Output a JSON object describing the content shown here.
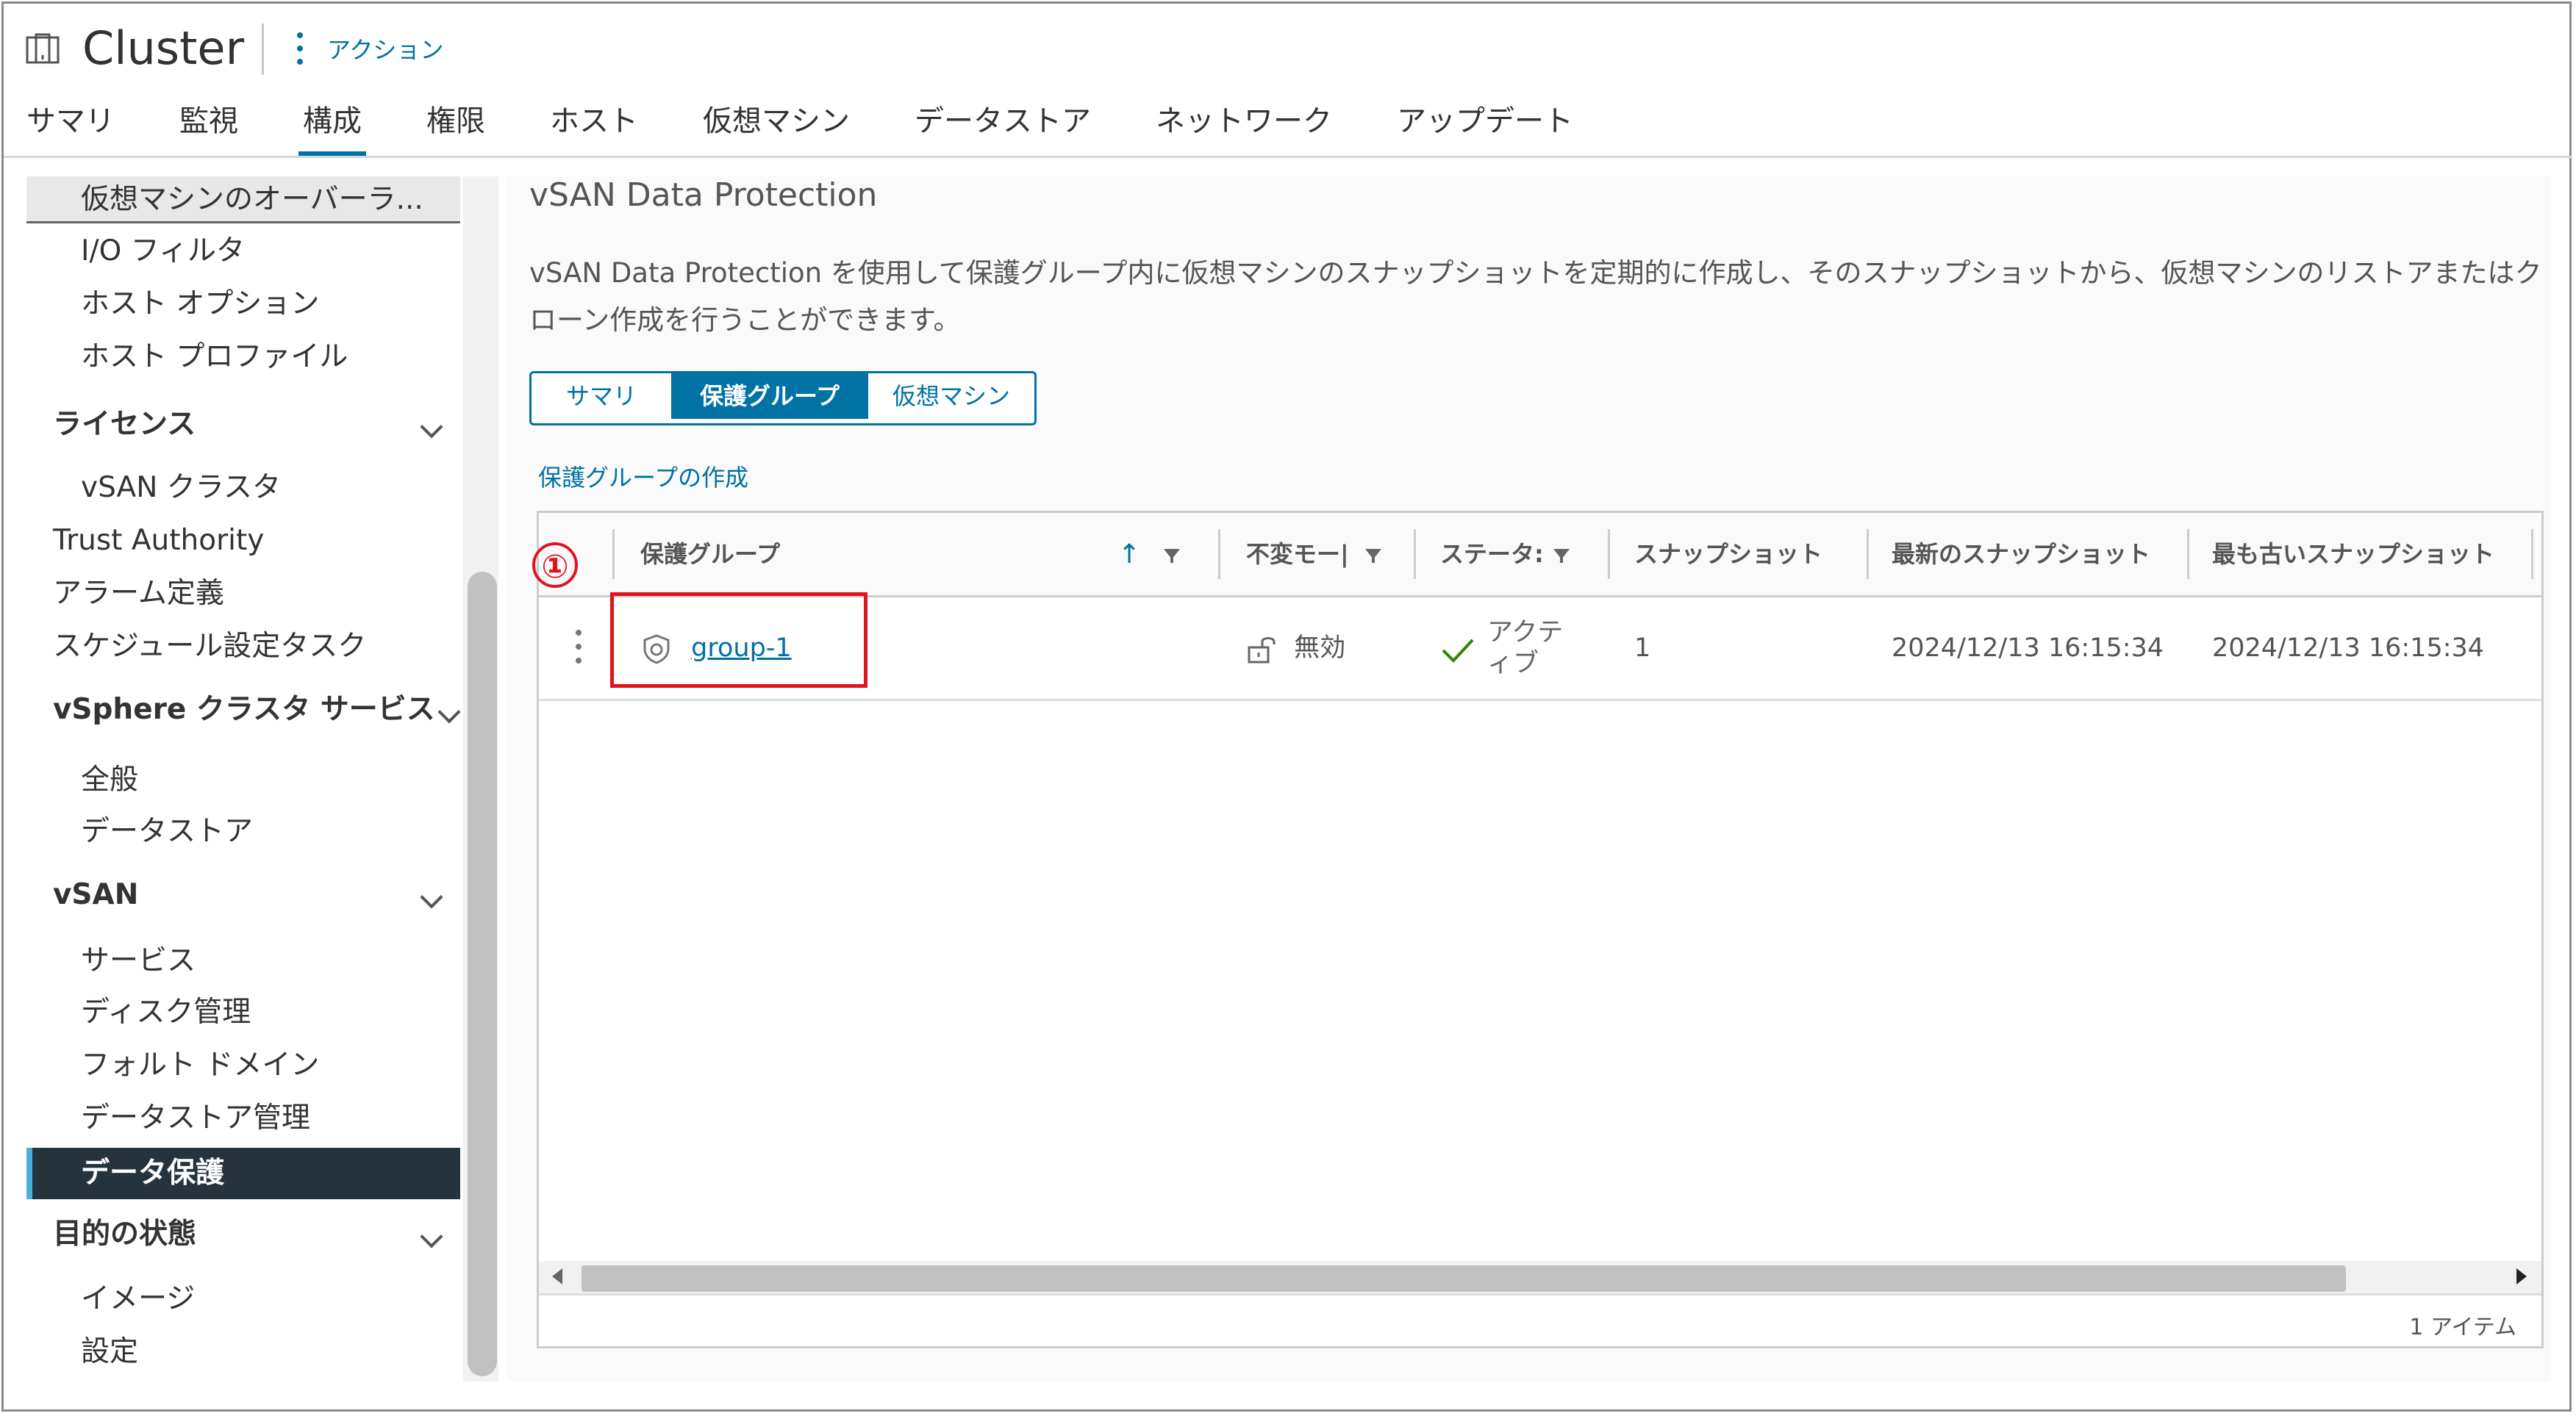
{
  "header": {
    "title": "Cluster",
    "actions_label": "アクション",
    "tabs": [
      "サマリ",
      "監視",
      "構成",
      "権限",
      "ホスト",
      "仮想マシン",
      "データストア",
      "ネットワーク",
      "アップデート"
    ],
    "active_tab": "構成"
  },
  "sidebar": {
    "items": [
      {
        "label": "仮想マシンのオーバーラ...",
        "level": 2,
        "state": "hover"
      },
      {
        "label": "I/O フィルタ",
        "level": 2
      },
      {
        "label": "ホスト オプション",
        "level": 2
      },
      {
        "label": "ホスト プロファイル",
        "level": 2
      },
      {
        "label": "ライセンス",
        "level": "group"
      },
      {
        "label": "vSAN クラスタ",
        "level": 2
      },
      {
        "label": "Trust Authority",
        "level": 1
      },
      {
        "label": "アラーム定義",
        "level": 1
      },
      {
        "label": "スケジュール設定タスク",
        "level": 1
      },
      {
        "label": "vSphere クラスタ サービス",
        "level": "group"
      },
      {
        "label": "全般",
        "level": 2
      },
      {
        "label": "データストア",
        "level": 2
      },
      {
        "label": "vSAN",
        "level": "group"
      },
      {
        "label": "サービス",
        "level": 2
      },
      {
        "label": "ディスク管理",
        "level": 2
      },
      {
        "label": "フォルト ドメイン",
        "level": 2
      },
      {
        "label": "データストア管理",
        "level": 2
      },
      {
        "label": "データ保護",
        "level": 2,
        "state": "selected"
      },
      {
        "label": "目的の状態",
        "level": "group"
      },
      {
        "label": "イメージ",
        "level": 2
      },
      {
        "label": "設定",
        "level": 2
      }
    ]
  },
  "main": {
    "title": "vSAN Data Protection",
    "description": "vSAN Data Protection を使用して保護グループ内に仮想マシンのスナップショットを定期的に作成し、そのスナップショットから、仮想マシンのリストアまたはクローン作成を行うことができます。",
    "subtabs": [
      "サマリ",
      "保護グループ",
      "仮想マシン"
    ],
    "active_subtab": "保護グループ",
    "create_link": "保護グループの作成",
    "grid": {
      "columns": [
        "保護グループ",
        "不変モード",
        "ステータス",
        "スナップショット",
        "最新のスナップショット",
        "最も古いスナップショット"
      ],
      "column_display": [
        "保護グループ",
        "不変モー|",
        "ステータ:",
        "スナップショット",
        "最新のスナップショット",
        "最も古いスナップショット"
      ],
      "rows": [
        {
          "group": "group-1",
          "immutable": "無効",
          "status": "アクティブ",
          "status_line1": "アクテ",
          "status_line2": "ィブ",
          "snapshots": "1",
          "latest": "2024/12/13 16:15:34",
          "oldest": "2024/12/13 16:15:34"
        }
      ],
      "footer": "1 アイテム"
    },
    "annotation_number": "①"
  },
  "colors": {
    "accent": "#0072a3",
    "selected_bg": "#25333d",
    "annotation": "#e0141e"
  }
}
